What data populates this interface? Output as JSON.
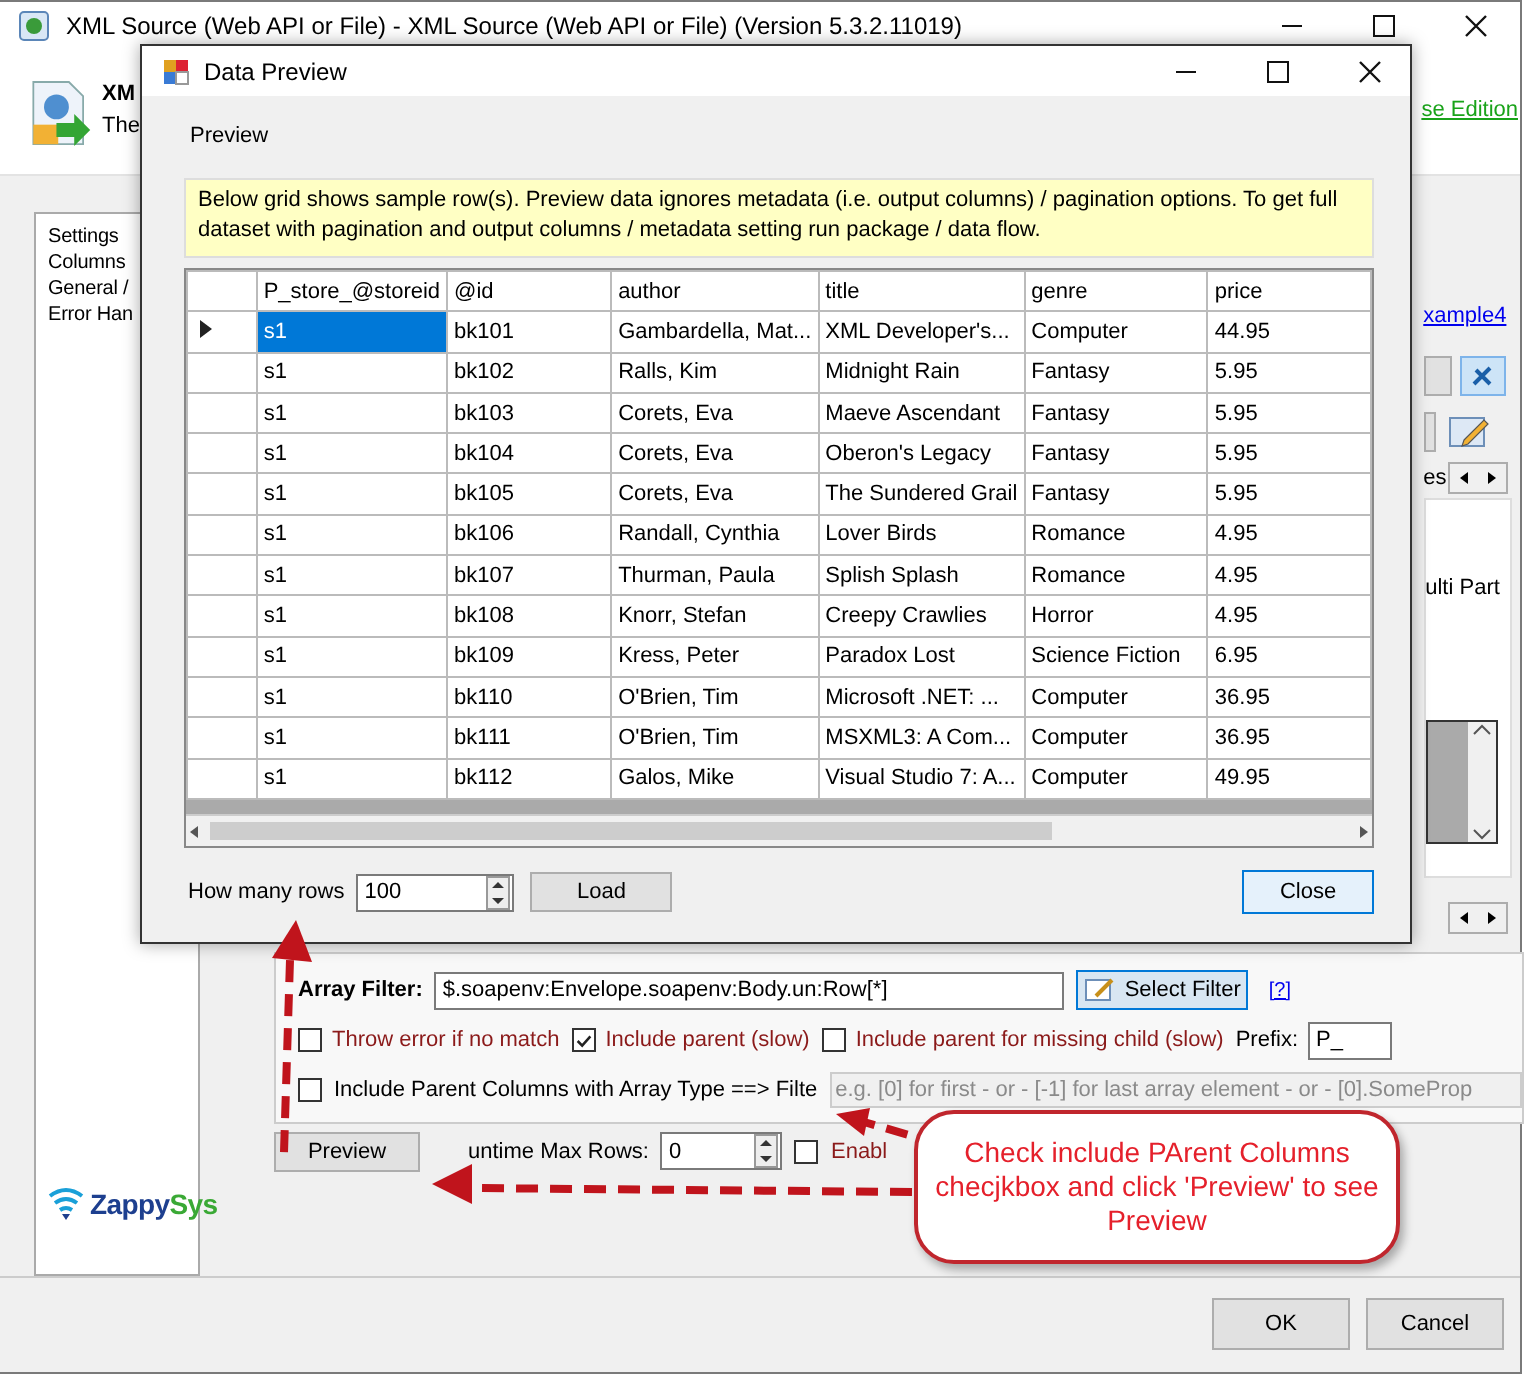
{
  "window": {
    "title": "XML Source (Web API or File) - XML Source (Web API or File) (Version 5.3.2.11019)",
    "header_title": "XM",
    "header_subtitle": "The",
    "edition_link": "se Edition"
  },
  "sidebar": {
    "items": [
      {
        "label": "Settings"
      },
      {
        "label": "Columns"
      },
      {
        "label": "General /"
      },
      {
        "label": "Error Han"
      }
    ]
  },
  "logo": {
    "name_first": "Zappy",
    "name_second": "Sys"
  },
  "settings_panel": {
    "link": "xample4",
    "tab_text": "es",
    "note": "ulti Part"
  },
  "array_filter": {
    "label": "Array Filter:",
    "value": "$.soapenv:Envelope.soapenv:Body.un:Row[*]",
    "button": "Select Filter",
    "help_link": "[?]"
  },
  "options": [
    {
      "label": "Throw error if no match",
      "checked": false
    },
    {
      "label": "Include parent (slow)",
      "checked": true
    },
    {
      "label": "Include parent for missing child (slow)",
      "checked": false
    }
  ],
  "prefix": {
    "label": "Prefix:",
    "value": "P_"
  },
  "parent_columns": {
    "label": "Include Parent Columns with Array Type ==> Filte",
    "checked": false,
    "filter_placeholder": "e.g. [0] for first - or - [-1] for last array element - or - [0].SomeProp"
  },
  "preview_button": "Preview",
  "max_rows": {
    "label": "untime Max Rows:",
    "value": "0"
  },
  "enable_option": {
    "label": "Enabl",
    "checked": false
  },
  "footer_buttons": [
    "OK",
    "Cancel"
  ],
  "dialog": {
    "title": "Data Preview",
    "section": "Preview",
    "notice": "Below grid shows sample row(s). Preview data ignores metadata (i.e. output columns) / pagination options. To get full dataset with pagination and output columns / metadata setting run package / data flow.",
    "grid": {
      "columns": [
        "P_store_@storeid",
        "@id",
        "author",
        "title",
        "genre",
        "price"
      ],
      "rows": [
        {
          "selected": true,
          "cells": [
            "s1",
            "bk101",
            "Gambardella, Mat...",
            "XML Developer's...",
            "Computer",
            "44.95"
          ]
        },
        {
          "selected": false,
          "cells": [
            "s1",
            "bk102",
            "Ralls, Kim",
            "Midnight Rain",
            "Fantasy",
            "5.95"
          ]
        },
        {
          "selected": false,
          "cells": [
            "s1",
            "bk103",
            "Corets, Eva",
            "Maeve Ascendant",
            "Fantasy",
            "5.95"
          ]
        },
        {
          "selected": false,
          "cells": [
            "s1",
            "bk104",
            "Corets, Eva",
            "Oberon's Legacy",
            "Fantasy",
            "5.95"
          ]
        },
        {
          "selected": false,
          "cells": [
            "s1",
            "bk105",
            "Corets, Eva",
            "The Sundered Grail",
            "Fantasy",
            "5.95"
          ]
        },
        {
          "selected": false,
          "cells": [
            "s1",
            "bk106",
            "Randall, Cynthia",
            "Lover Birds",
            "Romance",
            "4.95"
          ]
        },
        {
          "selected": false,
          "cells": [
            "s1",
            "bk107",
            "Thurman, Paula",
            "Splish Splash",
            "Romance",
            "4.95"
          ]
        },
        {
          "selected": false,
          "cells": [
            "s1",
            "bk108",
            "Knorr, Stefan",
            "Creepy Crawlies",
            "Horror",
            "4.95"
          ]
        },
        {
          "selected": false,
          "cells": [
            "s1",
            "bk109",
            "Kress, Peter",
            "Paradox Lost",
            "Science Fiction",
            "6.95"
          ]
        },
        {
          "selected": false,
          "cells": [
            "s1",
            "bk110",
            "O'Brien, Tim",
            "Microsoft .NET: ...",
            "Computer",
            "36.95"
          ]
        },
        {
          "selected": false,
          "cells": [
            "s1",
            "bk111",
            "O'Brien, Tim",
            "MSXML3: A Com...",
            "Computer",
            "36.95"
          ]
        },
        {
          "selected": false,
          "cells": [
            "s1",
            "bk112",
            "Galos, Mike",
            "Visual Studio 7: A...",
            "Computer",
            "49.95"
          ]
        }
      ]
    },
    "rows_label": "How many rows",
    "rows_value": "100",
    "load_button": "Load",
    "close_button": "Close"
  },
  "callout": {
    "text": "Check include PArent Columns checjkbox and click 'Preview' to see Preview"
  }
}
